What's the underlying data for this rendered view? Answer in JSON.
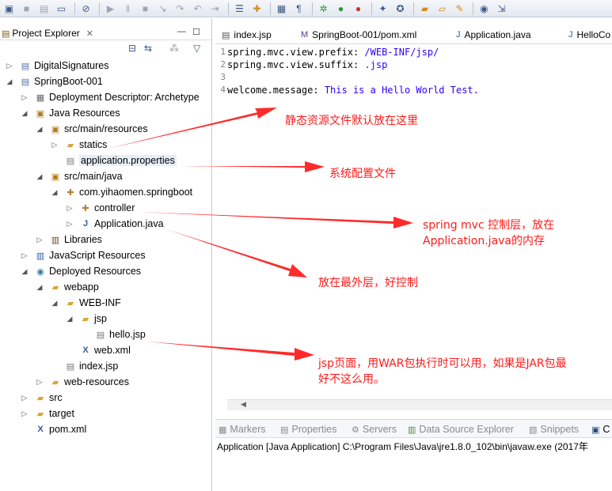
{
  "toolbar": {
    "icons": [
      "new-icon",
      "save-icon",
      "save-all-icon",
      "print-icon",
      "skip-breakpoints-icon",
      "resume-icon",
      "suspend-icon",
      "terminate-icon",
      "step-into-icon",
      "step-over-icon",
      "step-return-icon",
      "drop-to-frame-icon",
      "use-step-filters-icon",
      "open-console-icon",
      "toggle-block-icon",
      "debug-icon",
      "run-icon",
      "stop-server-icon",
      "new-wizard-icon",
      "new-class-icon",
      "open-type-icon",
      "open-task-icon",
      "search-icon",
      "open-perspective-icon"
    ]
  },
  "explorer": {
    "title": "Project Explorer",
    "tree": [
      {
        "label": "DigitalSignatures",
        "icon": "project-icon",
        "twisty": "collapsed"
      },
      {
        "label": "SpringBoot-001",
        "icon": "project-icon",
        "twisty": "expanded"
      },
      {
        "label": "Deployment Descriptor: Archetype",
        "icon": "deployment-descriptor-icon",
        "twisty": "collapsed"
      },
      {
        "label": "Java Resources",
        "icon": "java-resources-icon",
        "twisty": "expanded"
      },
      {
        "label": "src/main/resources",
        "icon": "source-folder-icon",
        "twisty": "expanded"
      },
      {
        "label": "statics",
        "icon": "folder-icon",
        "twisty": "collapsed"
      },
      {
        "label": "application.properties",
        "icon": "properties-file-icon",
        "twisty": "none"
      },
      {
        "label": "src/main/java",
        "icon": "source-folder-icon",
        "twisty": "expanded"
      },
      {
        "label": "com.yihaomen.springboot",
        "icon": "package-icon",
        "twisty": "expanded"
      },
      {
        "label": "controller",
        "icon": "package-icon",
        "twisty": "collapsed"
      },
      {
        "label": "Application.java",
        "icon": "java-file-icon",
        "twisty": "collapsed"
      },
      {
        "label": "Libraries",
        "icon": "libraries-icon",
        "twisty": "collapsed"
      },
      {
        "label": "JavaScript Resources",
        "icon": "javascript-resources-icon",
        "twisty": "collapsed"
      },
      {
        "label": "Deployed Resources",
        "icon": "deployed-resources-icon",
        "twisty": "expanded"
      },
      {
        "label": "webapp",
        "icon": "folder-icon",
        "twisty": "expanded"
      },
      {
        "label": "WEB-INF",
        "icon": "folder-icon",
        "twisty": "expanded"
      },
      {
        "label": "jsp",
        "icon": "folder-icon",
        "twisty": "expanded"
      },
      {
        "label": "hello.jsp",
        "icon": "jsp-file-icon",
        "twisty": "none"
      },
      {
        "label": "web.xml",
        "icon": "xml-file-icon",
        "twisty": "none"
      },
      {
        "label": "index.jsp",
        "icon": "jsp-file-icon",
        "twisty": "none"
      },
      {
        "label": "web-resources",
        "icon": "folder-icon",
        "twisty": "collapsed"
      },
      {
        "label": "src",
        "icon": "folder-icon",
        "twisty": "collapsed"
      },
      {
        "label": "target",
        "icon": "folder-icon",
        "twisty": "collapsed"
      },
      {
        "label": "pom.xml",
        "icon": "xml-file-icon",
        "twisty": "none"
      }
    ]
  },
  "editor": {
    "tabs": [
      "index.jsp",
      "SpringBoot-001/pom.xml",
      "Application.java",
      "HelloCo"
    ],
    "lines": [
      {
        "num": "1",
        "key": "spring.mvc.view.prefix:",
        "value": " /WEB-INF/jsp/"
      },
      {
        "num": "2",
        "key": "spring.mvc.view.suffix:",
        "value": " .jsp"
      },
      {
        "num": "3",
        "key": "",
        "value": ""
      },
      {
        "num": "4",
        "key": "welcome.message:",
        "value": " This is a Hello World Test."
      }
    ]
  },
  "bottom_panel": {
    "tabs": [
      "Markers",
      "Properties",
      "Servers",
      "Data Source Explorer",
      "Snippets",
      "C"
    ],
    "console_text": "Application [Java Application] C:\\Program Files\\Java\\jre1.8.0_102\\bin\\javaw.exe (2017年"
  },
  "annotations": {
    "note1": "静态资源文件默认放在这里",
    "note2": "系统配置文件",
    "note3_line1": "spring mvc 控制层，放在",
    "note3_line2": "Application.java的内存",
    "note4": "放在最外层，好控制",
    "note5_line1": "jsp页面，用WAR包执行时可以用，如果是JAR包最",
    "note5_line2": "好不这么用。",
    "color": "#ff1a1a"
  }
}
